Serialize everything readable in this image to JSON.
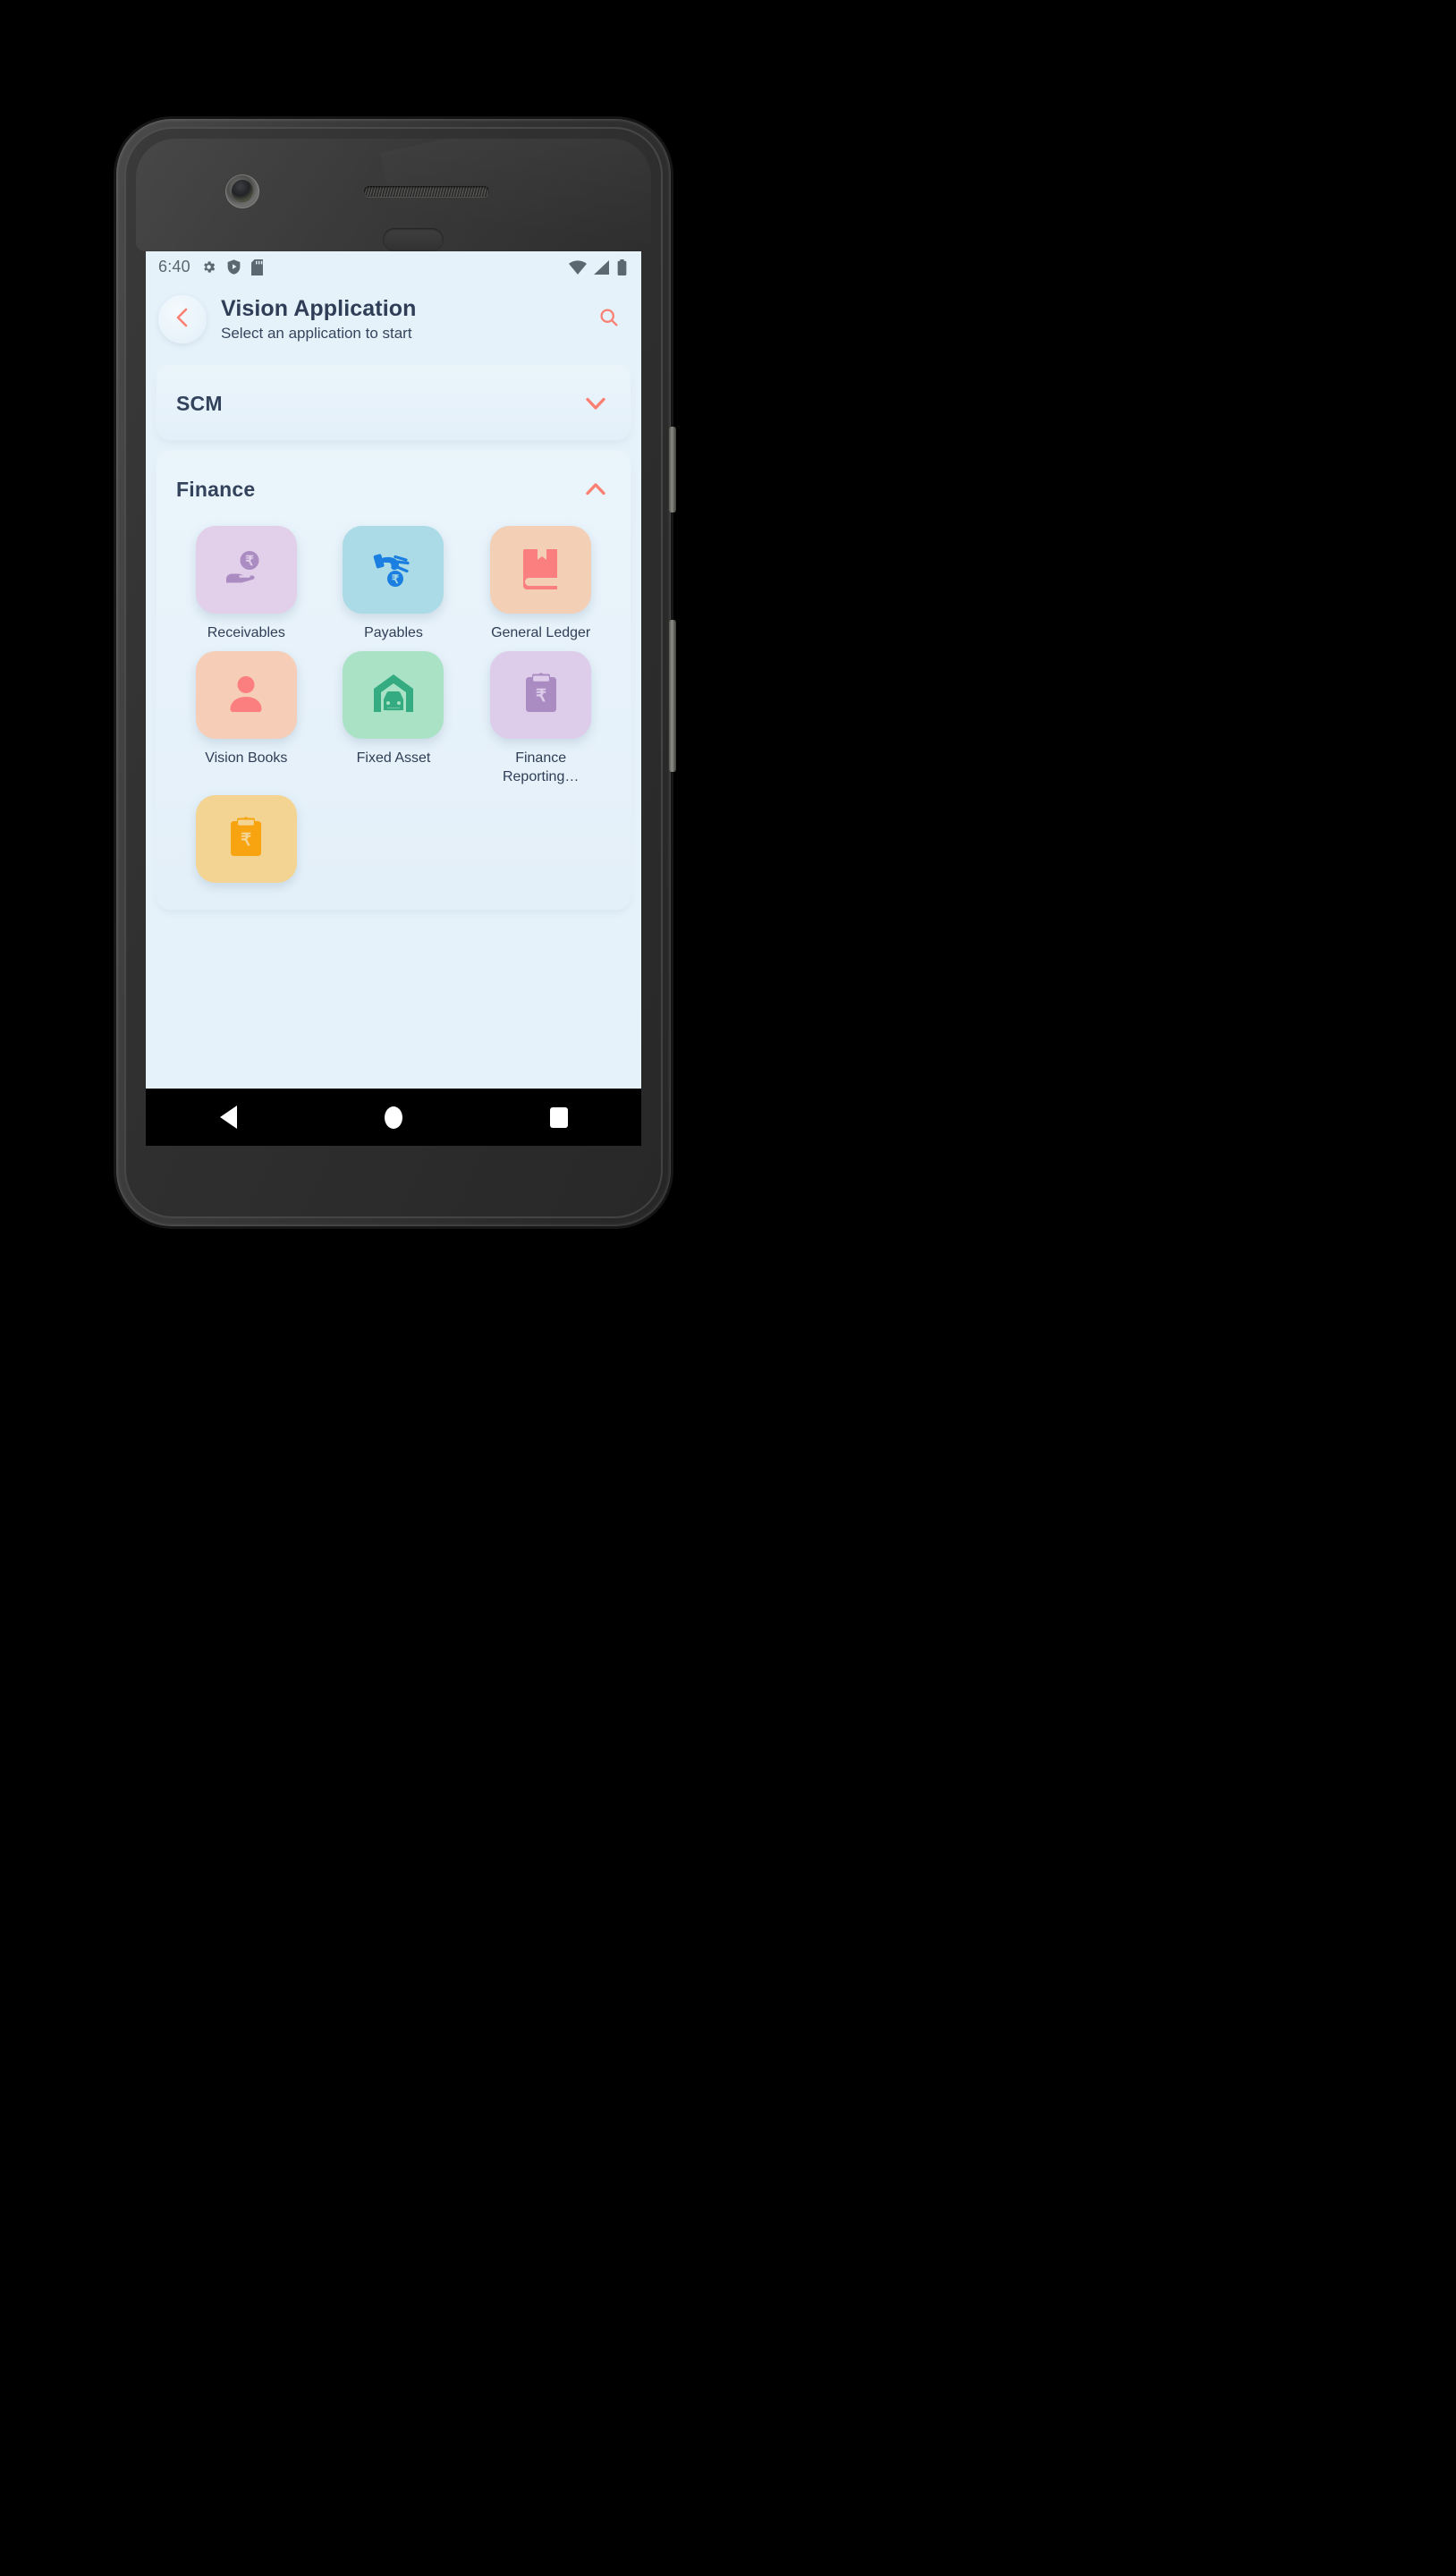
{
  "device": {
    "camera_icon": "front-camera-icon",
    "speaker_icon": "earpiece-speaker-icon",
    "power_button": "power-button",
    "volume_button": "volume-button"
  },
  "status_bar": {
    "time": "6:40",
    "left_icons": [
      "gear-icon",
      "shield-play-icon",
      "sd-card-icon"
    ],
    "right_icons": [
      "wifi-icon",
      "cellular-signal-icon",
      "battery-icon"
    ]
  },
  "app_bar": {
    "back_icon": "chevron-left-icon",
    "title": "Vision Application",
    "subtitle": "Select an application to start",
    "search_icon": "search-icon",
    "accent_color": "#fa8074",
    "title_color": "#2f3e56"
  },
  "sections": [
    {
      "title": "SCM",
      "expanded": false,
      "chevron_icon": "chevron-down-icon",
      "apps": []
    },
    {
      "title": "Finance",
      "expanded": true,
      "chevron_icon": "chevron-up-icon",
      "apps": [
        {
          "label": "Receivables",
          "icon": "hand-holding-rupee-icon",
          "tile_color": "#e2cfe9",
          "icon_color": "#ab8cc2"
        },
        {
          "label": "Payables",
          "icon": "hand-dropping-rupee-icon",
          "tile_color": "#aadbe6",
          "icon_color": "#1a7fe0"
        },
        {
          "label": "General Ledger",
          "icon": "ledger-book-icon",
          "tile_color": "#f3cfb6",
          "icon_color": "#fb7f7f"
        },
        {
          "label": "Vision Books",
          "icon": "person-icon",
          "tile_color": "#f6cdb7",
          "icon_color": "#fb7f7f"
        },
        {
          "label": "Fixed Asset",
          "icon": "garage-car-icon",
          "tile_color": "#a9e2c5",
          "icon_color": "#34ab81"
        },
        {
          "label": "Finance\nReporting…",
          "icon": "clipboard-rupee-icon",
          "tile_color": "#ddccea",
          "icon_color": "#ab8cc2"
        },
        {
          "label": "",
          "icon": "clipboard-rupee-icon",
          "tile_color": "#f3d493",
          "icon_color": "#f7a410"
        }
      ]
    }
  ],
  "nav_bar": {
    "back_label": "back-triangle",
    "home_label": "home-circle",
    "recents_label": "recents-square"
  }
}
